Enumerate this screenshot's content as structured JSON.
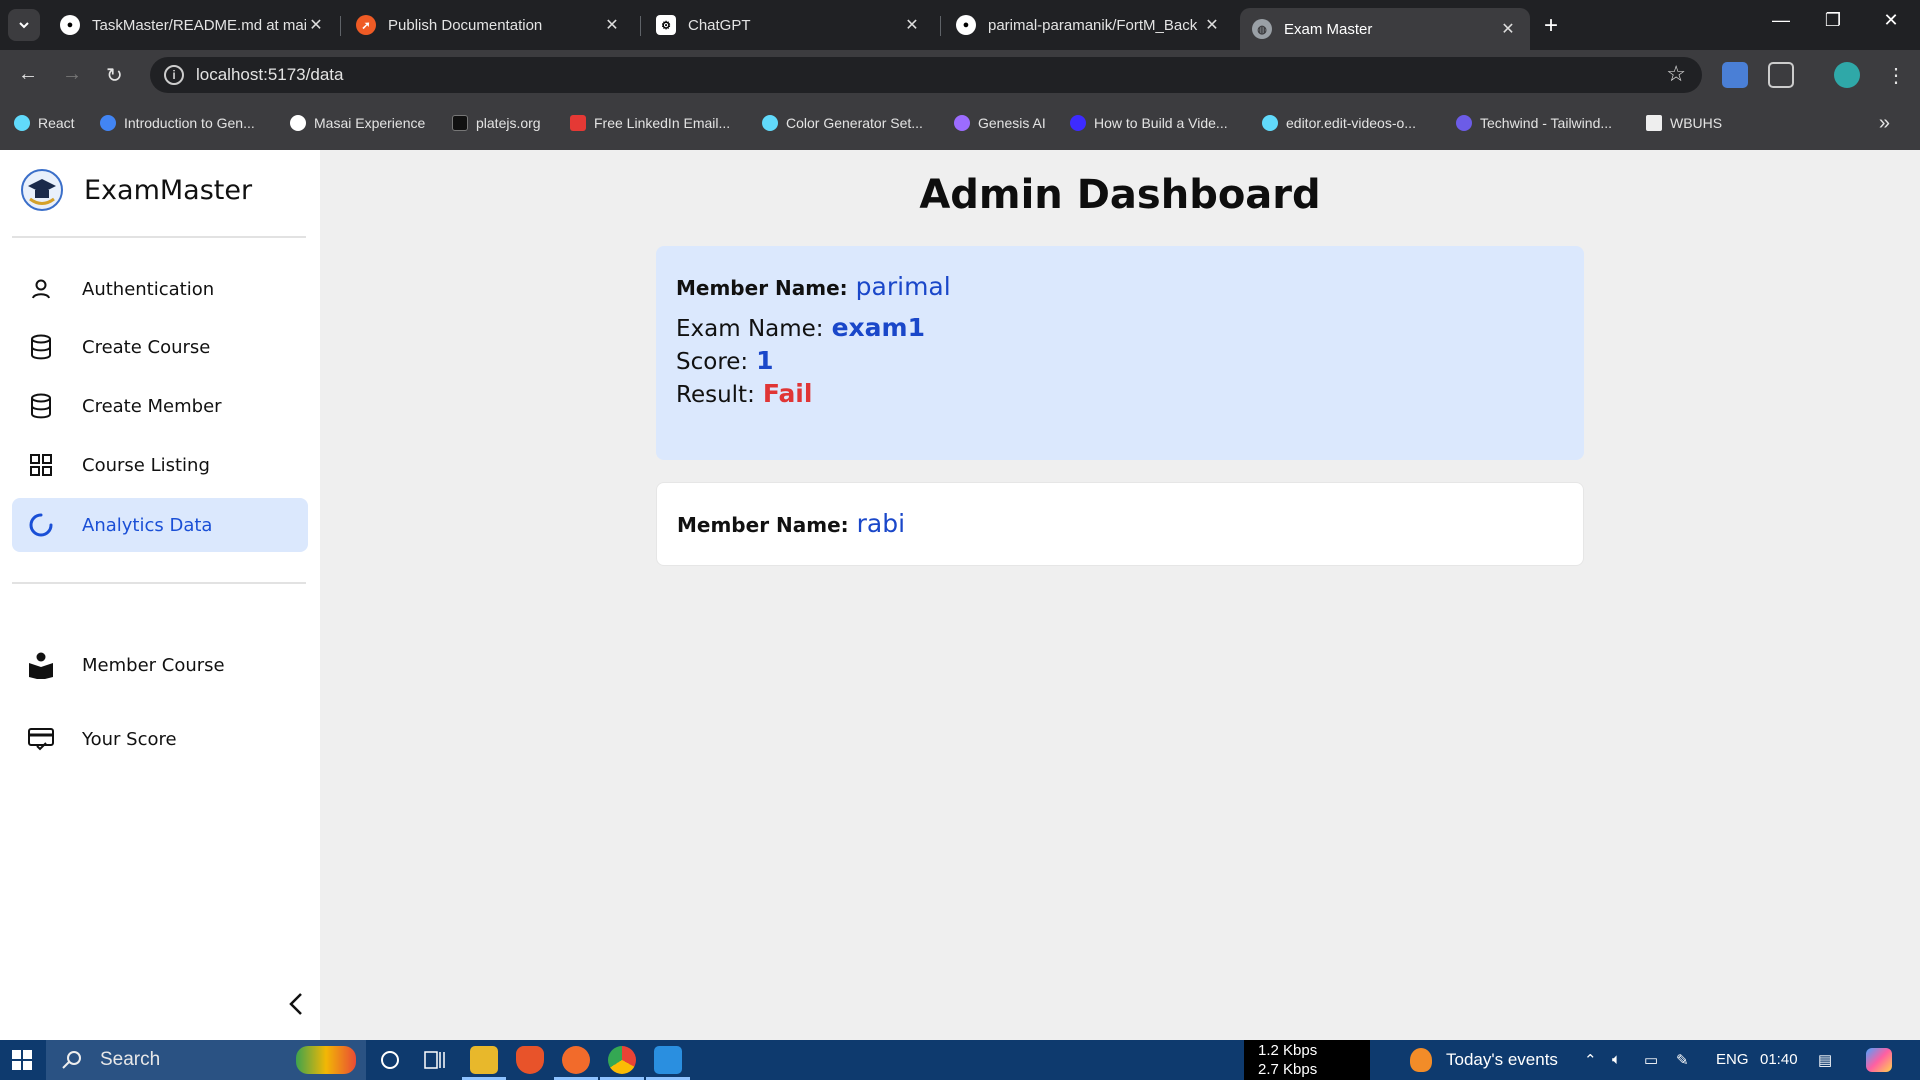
{
  "browser": {
    "tabs": [
      {
        "title": "TaskMaster/README.md at mai",
        "favicon": "github-icon"
      },
      {
        "title": "Publish Documentation",
        "favicon": "postman-icon"
      },
      {
        "title": "ChatGPT",
        "favicon": "chatgpt-icon"
      },
      {
        "title": "parimal-paramanik/FortM_Back",
        "favicon": "github-icon"
      },
      {
        "title": "Exam Master",
        "favicon": "globe-icon"
      }
    ],
    "active_tab": 4,
    "url": "localhost:5173/data",
    "bookmarks": [
      {
        "label": "React",
        "color": "#61dafb"
      },
      {
        "label": "Introduction to Gen...",
        "color": "#4285f4"
      },
      {
        "label": "Masai Experience",
        "color": "#ffffff"
      },
      {
        "label": "platejs.org",
        "color": "#111111"
      },
      {
        "label": "Free LinkedIn Email...",
        "color": "#e53935"
      },
      {
        "label": "Color Generator Set...",
        "color": "#61dafb"
      },
      {
        "label": "Genesis AI",
        "color": "#9c6cff"
      },
      {
        "label": "How to Build a Vide...",
        "color": "#3d2bff"
      },
      {
        "label": "editor.edit-videos-o...",
        "color": "#61dafb"
      },
      {
        "label": "Techwind - Tailwind...",
        "color": "#6c5ce7"
      },
      {
        "label": "WBUHS",
        "color": "#eeeeee"
      }
    ]
  },
  "app": {
    "brand": "ExamMaster",
    "nav": [
      {
        "label": "Authentication",
        "icon": "user-icon"
      },
      {
        "label": "Create Course",
        "icon": "database-icon"
      },
      {
        "label": "Create Member",
        "icon": "database-icon"
      },
      {
        "label": "Course Listing",
        "icon": "grid-icon"
      },
      {
        "label": "Analytics Data",
        "icon": "loader-icon",
        "active": true
      }
    ],
    "nav_secondary": [
      {
        "label": "Member Course",
        "icon": "reader-icon"
      },
      {
        "label": "Your Score",
        "icon": "scorecard-icon"
      }
    ]
  },
  "dashboard": {
    "title": "Admin Dashboard",
    "member_label": "Member Name:",
    "exam_label": "Exam Name:",
    "score_label": "Score:",
    "result_label": "Result:",
    "records": [
      {
        "member": "parimal",
        "exam": "exam1",
        "score": "1",
        "result": "Fail"
      },
      {
        "member": "rabi"
      }
    ]
  },
  "taskbar": {
    "search_placeholder": "Search",
    "net_up": "1.2 Kbps",
    "net_down": "2.7 Kbps",
    "events": "Today's events",
    "lang": "ENG",
    "time": "01:40"
  },
  "colors": {
    "accent": "#1a47c9",
    "fail": "#e03535",
    "active_bg": "#dbe8fd"
  }
}
